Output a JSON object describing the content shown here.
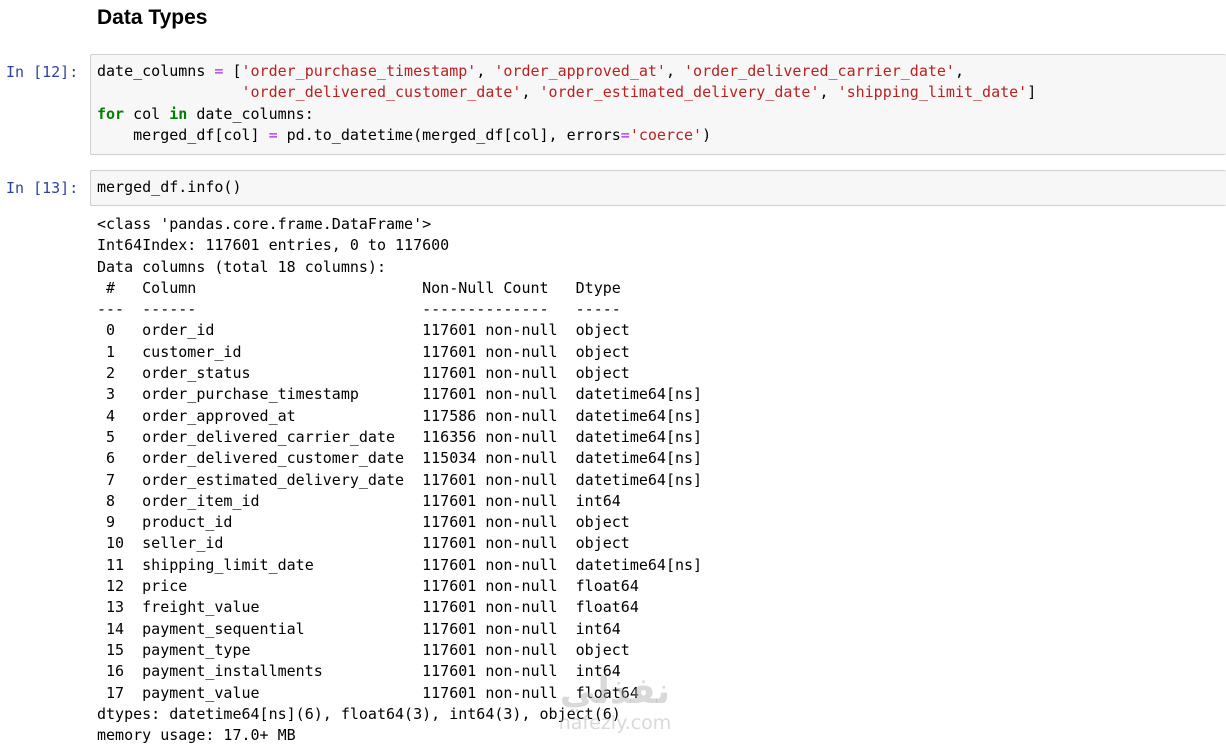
{
  "section_heading": "Data Types",
  "cell_12": {
    "prompt": "In [12]:",
    "code": {
      "l1_var": "date_columns ",
      "l1_op": "=",
      "l1_open": " [",
      "l1_s1": "'order_purchase_timestamp'",
      "l1_c1": ", ",
      "l1_s2": "'order_approved_at'",
      "l1_c2": ", ",
      "l1_s3": "'order_delivered_carrier_date'",
      "l1_c3": ",",
      "l2_indent": "                ",
      "l2_s1": "'order_delivered_customer_date'",
      "l2_c1": ", ",
      "l2_s2": "'order_estimated_delivery_date'",
      "l2_c2": ", ",
      "l2_s3": "'shipping_limit_date'",
      "l2_close": "]",
      "l3_for": "for",
      "l3_mid": " col ",
      "l3_in": "in",
      "l3_end": " date_columns:",
      "l4_a": "    merged_df[col] ",
      "l4_op": "=",
      "l4_b": " pd.to_datetime(merged_df[col], errors",
      "l4_op2": "=",
      "l4_str": "'coerce'",
      "l4_c": ")"
    }
  },
  "cell_13": {
    "prompt": "In [13]:",
    "code": "merged_df.info()",
    "output_lines": [
      "<class 'pandas.core.frame.DataFrame'>",
      "Int64Index: 117601 entries, 0 to 117600",
      "Data columns (total 18 columns):",
      " #   Column                         Non-Null Count   Dtype",
      "---  ------                         --------------   -----",
      " 0   order_id                       117601 non-null  object",
      " 1   customer_id                    117601 non-null  object",
      " 2   order_status                   117601 non-null  object",
      " 3   order_purchase_timestamp       117601 non-null  datetime64[ns]",
      " 4   order_approved_at              117586 non-null  datetime64[ns]",
      " 5   order_delivered_carrier_date   116356 non-null  datetime64[ns]",
      " 6   order_delivered_customer_date  115034 non-null  datetime64[ns]",
      " 7   order_estimated_delivery_date  117601 non-null  datetime64[ns]",
      " 8   order_item_id                  117601 non-null  int64",
      " 9   product_id                     117601 non-null  object",
      " 10  seller_id                      117601 non-null  object",
      " 11  shipping_limit_date            117601 non-null  datetime64[ns]",
      " 12  price                          117601 non-null  float64",
      " 13  freight_value                  117601 non-null  float64",
      " 14  payment_sequential             117601 non-null  int64",
      " 15  payment_type                   117601 non-null  object",
      " 16  payment_installments           117601 non-null  int64",
      " 17  payment_value                  117601 non-null  float64",
      "dtypes: datetime64[ns](6), float64(3), int64(3), object(6)",
      "memory usage: 17.0+ MB"
    ]
  },
  "watermark": {
    "logo_text": "نفذلي",
    "site_text": "nafezly.com"
  },
  "colors": {
    "prompt": "#303f9f",
    "keyword": "#008000",
    "operator": "#aa22ff",
    "string": "#ba2121",
    "input_bg": "#f7f7f7",
    "input_border": "#cfcfcf"
  }
}
